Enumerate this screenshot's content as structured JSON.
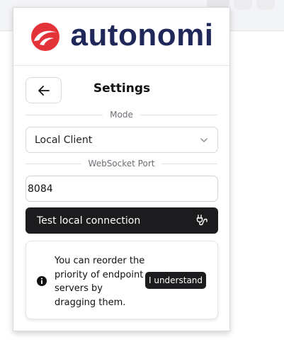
{
  "header": {
    "brand": "autonomi",
    "logo_icon": "autonomi-logo-icon",
    "brand_color": "#20285a",
    "logo_color": "#e33338"
  },
  "page": {
    "title": "Settings",
    "back_icon": "arrow-left-icon"
  },
  "mode": {
    "label": "Mode",
    "selected": "Local Client",
    "chevron_icon": "chevron-down-icon"
  },
  "websocket": {
    "label": "WebSocket Port",
    "value": "8084"
  },
  "test_button": {
    "label": "Test local connection",
    "icon": "plug-icon"
  },
  "notice": {
    "icon": "info-icon",
    "message": "You can reorder the priority of endpoint servers by dragging them.",
    "button_label": "I understand"
  }
}
